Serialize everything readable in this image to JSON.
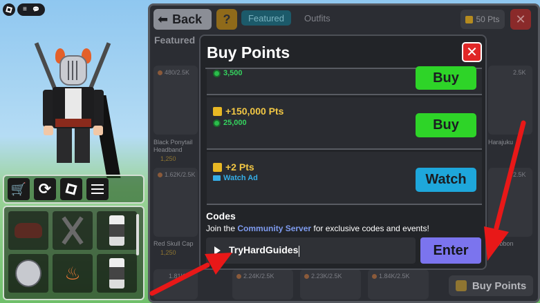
{
  "roblox_menu": {
    "menu_glyph": "≡",
    "chat_glyph": "💬"
  },
  "toolbar": {
    "cart_glyph": "🛒",
    "refresh_glyph": "⟳"
  },
  "header": {
    "back_label": "Back",
    "back_glyph": "⬅",
    "help_label": "?",
    "tabs": [
      {
        "label": "Featured"
      },
      {
        "label": "Outfits"
      }
    ],
    "points_badge": "50 Pts",
    "close_label": "✕"
  },
  "featured_heading": "Featured",
  "background_items": [
    {
      "meta": "480/2.5K",
      "name": "Black Ponytail Headband",
      "price": "1,250"
    },
    {
      "meta": "1.62K/2.5K",
      "name": "Red Skull Cap",
      "price": "1,250"
    },
    {
      "meta": "2.5K",
      "name": "Harajuku",
      "price": ""
    },
    {
      "meta": "2.5K",
      "name": "Ribbon",
      "price": ""
    },
    {
      "meta": "1.81K",
      "name": "",
      "price": ""
    },
    {
      "meta": "2.24K/2.5K",
      "name": "",
      "price": ""
    },
    {
      "meta": "2.23K/2.5K",
      "name": "",
      "price": ""
    },
    {
      "meta": "1.84K/2.5K",
      "name": "",
      "price": ""
    }
  ],
  "buy_points_button": "Buy Points",
  "modal": {
    "title": "Buy Points",
    "close_label": "✕",
    "offers": [
      {
        "title": "",
        "cost": "3,500",
        "button": "Buy"
      },
      {
        "title": "+150,000 Pts",
        "cost": "25,000",
        "button": "Buy"
      },
      {
        "title": "+2 Pts",
        "cost": "Watch Ad",
        "button": "Watch"
      }
    ],
    "codes": {
      "label": "Codes",
      "desc_prefix": "Join the ",
      "desc_link": "Community Server",
      "desc_suffix": " for exclusive codes and events!",
      "input_value": "TryHardGuides",
      "enter_label": "Enter"
    }
  },
  "colors": {
    "accent_green": "#2ed428",
    "accent_blue": "#1ea7db",
    "enter_purple": "#7b74ee",
    "close_red": "#e02727",
    "points_gold": "#f2c744",
    "arrow_red": "#e81818"
  }
}
